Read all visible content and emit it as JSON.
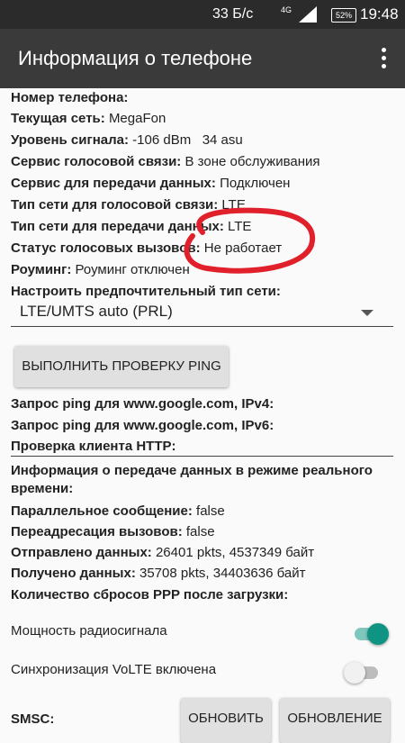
{
  "status_bar": {
    "speed": "33 Б/с",
    "network": "4G",
    "battery": "52%",
    "time": "19:48"
  },
  "app_bar": {
    "title": "Информация о телефоне"
  },
  "info": {
    "phone_number": {
      "label": "Номер телефона:",
      "value": ""
    },
    "current_network": {
      "label": "Текущая сеть:",
      "value": "MegaFon"
    },
    "signal_level": {
      "label": "Уровень сигнала:",
      "value": "-106 dBm   34 asu"
    },
    "voice_service": {
      "label": "Сервис голосовой связи:",
      "value": "В зоне обслуживания"
    },
    "data_service": {
      "label": "Сервис для передачи данных:",
      "value": "Подключен"
    },
    "voice_network_type": {
      "label": "Тип сети для голосовой связи:",
      "value": "LTE"
    },
    "data_network_type": {
      "label": "Тип сети для передачи данных:",
      "value": "LTE"
    },
    "voice_call_status": {
      "label": "Статус голосовых вызовов:",
      "value": "Не работает"
    },
    "roaming": {
      "label": "Роуминг:",
      "value": "Роуминг отключен"
    },
    "preferred_network": {
      "label": "Настроить предпочтительный тип сети:"
    }
  },
  "network_spinner": {
    "value": "LTE/UMTS auto (PRL)"
  },
  "ping_button": {
    "label": "ВЫПОЛНИТЬ ПРОВЕРКУ PING"
  },
  "ping": {
    "ipv4": {
      "label": "Запрос ping для www.google.com, IPv4:",
      "value": ""
    },
    "ipv6": {
      "label": "Запрос ping для www.google.com, IPv6:",
      "value": ""
    },
    "http": {
      "label": "Проверка клиента HTTP:",
      "value": ""
    }
  },
  "realtime": {
    "title_line1": "Информация о передаче данных в режиме реального",
    "title_line2": "времени:",
    "parallel_msg": {
      "label": "Параллельное сообщение:",
      "value": "false"
    },
    "call_forward": {
      "label": "Переадресация вызовов:",
      "value": "false"
    },
    "sent": {
      "label": "Отправлено данных:",
      "value": "26401 pkts, 4537349 байт"
    },
    "received": {
      "label": "Получено данных:",
      "value": "35708 pkts, 34403636 байт"
    },
    "ppp_resets": {
      "label": "Количество сбросов PPP после загрузки:",
      "value": ""
    }
  },
  "toggles": {
    "radio_power": {
      "label": "Мощность радиосигнала",
      "on": true
    },
    "volte_sync": {
      "label": "Синхронизация VoLTE включена",
      "on": false
    }
  },
  "smsc": {
    "label": "SMSC:",
    "update_button": "ОБНОВИТЬ",
    "refresh_button": "ОБНОВЛЕНИЕ"
  },
  "colors": {
    "accent": "#0f9484",
    "annotation": "#e0202a",
    "app_bar": "#3a3a3a",
    "status_bar": "#2b2b2b"
  }
}
